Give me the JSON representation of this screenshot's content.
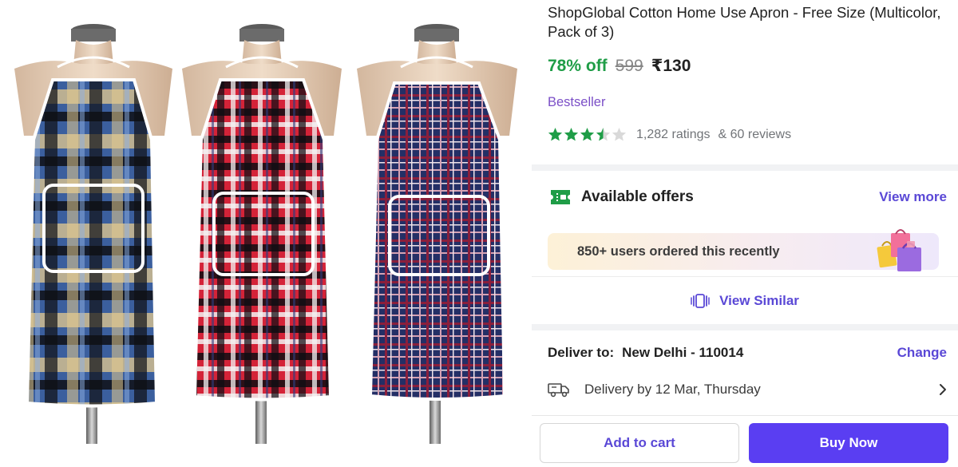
{
  "product": {
    "title": "ShopGlobal Cotton Home Use Apron - Free Size (Multicolor, Pack of 3)",
    "discount": "78% off",
    "mrp": "599",
    "price": "₹130",
    "badge": "Bestseller",
    "rating_stars": 3.5,
    "ratings_count": "1,282 ratings",
    "reviews_count": "& 60 reviews",
    "image_icon": "apron-product-photo"
  },
  "offers": {
    "title": "Available offers",
    "view_more": "View more",
    "social_proof": "850+ users ordered this recently",
    "icon": "ticket-icon"
  },
  "similar": {
    "label": "View Similar",
    "icon": "similar-cards-icon"
  },
  "delivery": {
    "deliver_to_label": "Deliver to:",
    "location": "New Delhi - 110014",
    "change": "Change",
    "eta": "Delivery by 12 Mar, Thursday",
    "icon": "truck-icon"
  },
  "actions": {
    "add_to_cart": "Add to cart",
    "buy_now": "Buy Now"
  },
  "colors": {
    "accent": "#5a3ef2",
    "link": "#5a48d6",
    "discount": "#1f9d47",
    "star": "#1f9d47",
    "bestseller": "#7b4fc7"
  }
}
